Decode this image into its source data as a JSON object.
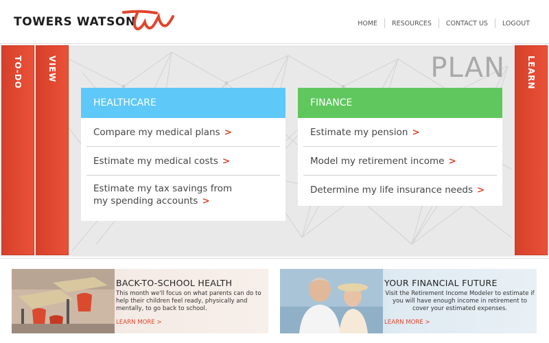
{
  "header": {
    "brand": "TOWERS WATSON",
    "logo_icon": "tw-swoosh-logo",
    "nav": [
      "HOME",
      "RESOURCES",
      "CONTACT US",
      "LOGOUT"
    ]
  },
  "side_tabs": {
    "todo": "TO-DO",
    "view": "VIEW",
    "learn": "LEARN"
  },
  "main": {
    "title": "PLAN",
    "healthcare": {
      "heading": "HEALTHCARE",
      "items": [
        "Compare my medical plans",
        "Estimate my medical costs",
        "Estimate my tax savings from my spending accounts"
      ]
    },
    "finance": {
      "heading": "FINANCE",
      "items": [
        "Estimate my pension",
        "Model my retirement income",
        "Determine my life insurance needs"
      ]
    },
    "arrow": ">"
  },
  "promos": [
    {
      "title": "BACK-TO-SCHOOL HEALTH",
      "text": "This month we'll focus on what parents can do to help their children feel ready, physically and mentally, to go back to school.",
      "link": "LEARN MORE >"
    },
    {
      "title": "YOUR FINANCIAL FUTURE",
      "text": "Visit the Retirement Income Modeler to estimate if you will have enough income in retirement to cover your estimated expenses.",
      "link": "LEARN MORE >"
    }
  ],
  "colors": {
    "accent_red": "#e0452b",
    "healthcare_blue": "#5ec8f8",
    "finance_green": "#60c75f",
    "plan_grey": "#a9a9a9"
  }
}
